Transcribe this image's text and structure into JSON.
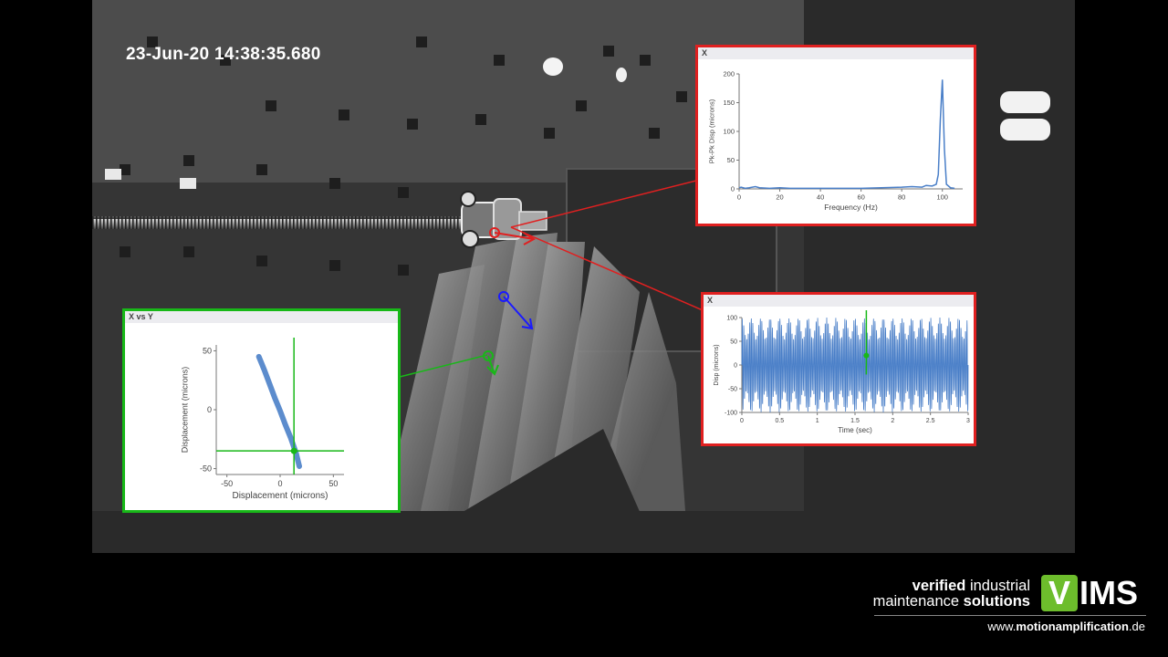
{
  "video": {
    "timestamp": "23-Jun-20 14:38:35.680"
  },
  "colors": {
    "red_marker": "#e02020",
    "green_marker": "#18b818",
    "blue_marker": "#1a1aff",
    "series": "#4a7fc8",
    "brand_green": "#6dbd2c"
  },
  "charts": [
    {
      "panel_title": "X",
      "chart_data": {
        "type": "line",
        "title": "",
        "xlabel": "Frequency (Hz)",
        "ylabel": "Pk-Pk Disp (microns)",
        "xlim": [
          0,
          110
        ],
        "ylim": [
          0,
          200
        ],
        "xticks": [
          0,
          20,
          40,
          60,
          80,
          100
        ],
        "yticks": [
          0,
          50,
          100,
          150,
          200
        ],
        "grid": false,
        "series": [
          {
            "x": [
              0,
              1,
              3,
              5,
              8,
              10,
              15,
              20,
              25,
              30,
              40,
              50,
              60,
              70,
              80,
              85,
              90,
              92,
              95,
              97,
              98,
              99,
              100,
              101,
              102,
              104,
              106
            ],
            "values": [
              2,
              3,
              1,
              2,
              4,
              2,
              1,
              2,
              1,
              1,
              1,
              1,
              1,
              2,
              3,
              4,
              3,
              6,
              5,
              8,
              25,
              120,
              190,
              70,
              8,
              2,
              1
            ]
          }
        ]
      }
    },
    {
      "panel_title": "X",
      "chart_data": {
        "type": "line",
        "title": "",
        "xlabel": "Time (sec)",
        "ylabel": "Disp (microns)",
        "xlim": [
          0,
          3
        ],
        "ylim": [
          -100,
          100
        ],
        "xticks": [
          0,
          0.5,
          1,
          1.5,
          2,
          2.5,
          3
        ],
        "yticks": [
          -100,
          -50,
          0,
          50,
          100
        ],
        "grid": false,
        "cursor_x": 1.65,
        "series": [
          {
            "frequency_hz": 100,
            "beat_frequency_hz": 8,
            "amplitude_max": 100,
            "amplitude_min": 55
          }
        ]
      }
    },
    {
      "panel_title": "X vs Y",
      "chart_data": {
        "type": "scatter",
        "title": "",
        "xlabel": "Displacement (microns)",
        "ylabel": "Displacement (microns)",
        "xlim": [
          -60,
          60
        ],
        "ylim": [
          -55,
          55
        ],
        "xticks": [
          -50,
          0,
          50
        ],
        "yticks": [
          -50,
          0,
          50
        ],
        "grid": false,
        "cursor": [
          13,
          -35
        ],
        "series": [
          {
            "x": [
              -20,
              -15,
              -10,
              -5,
              0,
              5,
              10,
              15,
              18
            ],
            "values": [
              45,
              34,
              22,
              10,
              -1,
              -13,
              -24,
              -37,
              -48
            ]
          }
        ]
      }
    }
  ],
  "brand": {
    "line1_bold": "verified",
    "line1_rest": " industrial",
    "line2_rest": "maintenance ",
    "line2_bold": "solutions",
    "logo_v": "V",
    "logo_rest": "IMS",
    "url_prefix": "www.",
    "url_bold": "motionamplification",
    "url_suffix": ".de"
  }
}
